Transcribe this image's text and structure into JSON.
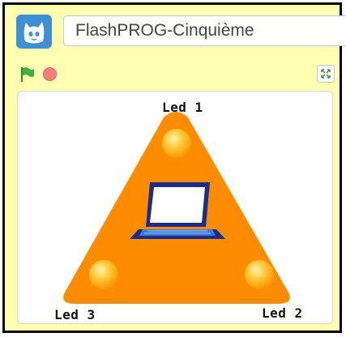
{
  "header": {
    "app_icon": "scratch-cat-icon",
    "project_title": "FlashPROG-Cinquième"
  },
  "controls": {
    "green_flag_icon": "green-flag-icon",
    "stop_icon": "stop-icon",
    "fullscreen_icon": "fullscreen-icon"
  },
  "stage": {
    "leds": [
      {
        "label": "Led 1"
      },
      {
        "label": "Led 2"
      },
      {
        "label": "Led 3"
      }
    ],
    "center_icon": "laptop-icon"
  },
  "colors": {
    "background": "#fffdb0",
    "triangle": "#ff8c00",
    "led": "#ffc43a",
    "stop": "#f08080",
    "flag": "#3cb043"
  }
}
